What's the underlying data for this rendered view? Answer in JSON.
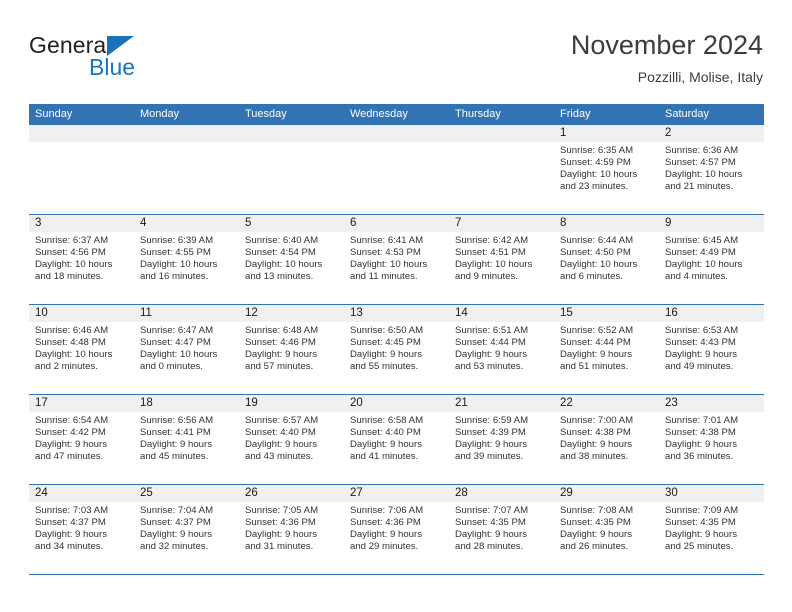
{
  "brand": {
    "name_top": "General",
    "name_bottom": "Blue",
    "accent_color": "#1d71b8",
    "blue_text_color": "#1577c4"
  },
  "header": {
    "title": "November 2024",
    "subtitle": "Pozzilli, Molise, Italy"
  },
  "calendar": {
    "header_bg": "#3273b3",
    "day_band_bg": "#f0f0f0",
    "weekdays": [
      "Sunday",
      "Monday",
      "Tuesday",
      "Wednesday",
      "Thursday",
      "Friday",
      "Saturday"
    ],
    "weeks": [
      [
        {
          "day": "",
          "empty": true
        },
        {
          "day": "",
          "empty": true
        },
        {
          "day": "",
          "empty": true
        },
        {
          "day": "",
          "empty": true
        },
        {
          "day": "",
          "empty": true
        },
        {
          "day": "1",
          "sunrise": "Sunrise: 6:35 AM",
          "sunset": "Sunset: 4:59 PM",
          "daylight1": "Daylight: 10 hours",
          "daylight2": "and 23 minutes."
        },
        {
          "day": "2",
          "sunrise": "Sunrise: 6:36 AM",
          "sunset": "Sunset: 4:57 PM",
          "daylight1": "Daylight: 10 hours",
          "daylight2": "and 21 minutes."
        }
      ],
      [
        {
          "day": "3",
          "sunrise": "Sunrise: 6:37 AM",
          "sunset": "Sunset: 4:56 PM",
          "daylight1": "Daylight: 10 hours",
          "daylight2": "and 18 minutes."
        },
        {
          "day": "4",
          "sunrise": "Sunrise: 6:39 AM",
          "sunset": "Sunset: 4:55 PM",
          "daylight1": "Daylight: 10 hours",
          "daylight2": "and 16 minutes."
        },
        {
          "day": "5",
          "sunrise": "Sunrise: 6:40 AM",
          "sunset": "Sunset: 4:54 PM",
          "daylight1": "Daylight: 10 hours",
          "daylight2": "and 13 minutes."
        },
        {
          "day": "6",
          "sunrise": "Sunrise: 6:41 AM",
          "sunset": "Sunset: 4:53 PM",
          "daylight1": "Daylight: 10 hours",
          "daylight2": "and 11 minutes."
        },
        {
          "day": "7",
          "sunrise": "Sunrise: 6:42 AM",
          "sunset": "Sunset: 4:51 PM",
          "daylight1": "Daylight: 10 hours",
          "daylight2": "and 9 minutes."
        },
        {
          "day": "8",
          "sunrise": "Sunrise: 6:44 AM",
          "sunset": "Sunset: 4:50 PM",
          "daylight1": "Daylight: 10 hours",
          "daylight2": "and 6 minutes."
        },
        {
          "day": "9",
          "sunrise": "Sunrise: 6:45 AM",
          "sunset": "Sunset: 4:49 PM",
          "daylight1": "Daylight: 10 hours",
          "daylight2": "and 4 minutes."
        }
      ],
      [
        {
          "day": "10",
          "sunrise": "Sunrise: 6:46 AM",
          "sunset": "Sunset: 4:48 PM",
          "daylight1": "Daylight: 10 hours",
          "daylight2": "and 2 minutes."
        },
        {
          "day": "11",
          "sunrise": "Sunrise: 6:47 AM",
          "sunset": "Sunset: 4:47 PM",
          "daylight1": "Daylight: 10 hours",
          "daylight2": "and 0 minutes."
        },
        {
          "day": "12",
          "sunrise": "Sunrise: 6:48 AM",
          "sunset": "Sunset: 4:46 PM",
          "daylight1": "Daylight: 9 hours",
          "daylight2": "and 57 minutes."
        },
        {
          "day": "13",
          "sunrise": "Sunrise: 6:50 AM",
          "sunset": "Sunset: 4:45 PM",
          "daylight1": "Daylight: 9 hours",
          "daylight2": "and 55 minutes."
        },
        {
          "day": "14",
          "sunrise": "Sunrise: 6:51 AM",
          "sunset": "Sunset: 4:44 PM",
          "daylight1": "Daylight: 9 hours",
          "daylight2": "and 53 minutes."
        },
        {
          "day": "15",
          "sunrise": "Sunrise: 6:52 AM",
          "sunset": "Sunset: 4:44 PM",
          "daylight1": "Daylight: 9 hours",
          "daylight2": "and 51 minutes."
        },
        {
          "day": "16",
          "sunrise": "Sunrise: 6:53 AM",
          "sunset": "Sunset: 4:43 PM",
          "daylight1": "Daylight: 9 hours",
          "daylight2": "and 49 minutes."
        }
      ],
      [
        {
          "day": "17",
          "sunrise": "Sunrise: 6:54 AM",
          "sunset": "Sunset: 4:42 PM",
          "daylight1": "Daylight: 9 hours",
          "daylight2": "and 47 minutes."
        },
        {
          "day": "18",
          "sunrise": "Sunrise: 6:56 AM",
          "sunset": "Sunset: 4:41 PM",
          "daylight1": "Daylight: 9 hours",
          "daylight2": "and 45 minutes."
        },
        {
          "day": "19",
          "sunrise": "Sunrise: 6:57 AM",
          "sunset": "Sunset: 4:40 PM",
          "daylight1": "Daylight: 9 hours",
          "daylight2": "and 43 minutes."
        },
        {
          "day": "20",
          "sunrise": "Sunrise: 6:58 AM",
          "sunset": "Sunset: 4:40 PM",
          "daylight1": "Daylight: 9 hours",
          "daylight2": "and 41 minutes."
        },
        {
          "day": "21",
          "sunrise": "Sunrise: 6:59 AM",
          "sunset": "Sunset: 4:39 PM",
          "daylight1": "Daylight: 9 hours",
          "daylight2": "and 39 minutes."
        },
        {
          "day": "22",
          "sunrise": "Sunrise: 7:00 AM",
          "sunset": "Sunset: 4:38 PM",
          "daylight1": "Daylight: 9 hours",
          "daylight2": "and 38 minutes."
        },
        {
          "day": "23",
          "sunrise": "Sunrise: 7:01 AM",
          "sunset": "Sunset: 4:38 PM",
          "daylight1": "Daylight: 9 hours",
          "daylight2": "and 36 minutes."
        }
      ],
      [
        {
          "day": "24",
          "sunrise": "Sunrise: 7:03 AM",
          "sunset": "Sunset: 4:37 PM",
          "daylight1": "Daylight: 9 hours",
          "daylight2": "and 34 minutes."
        },
        {
          "day": "25",
          "sunrise": "Sunrise: 7:04 AM",
          "sunset": "Sunset: 4:37 PM",
          "daylight1": "Daylight: 9 hours",
          "daylight2": "and 32 minutes."
        },
        {
          "day": "26",
          "sunrise": "Sunrise: 7:05 AM",
          "sunset": "Sunset: 4:36 PM",
          "daylight1": "Daylight: 9 hours",
          "daylight2": "and 31 minutes."
        },
        {
          "day": "27",
          "sunrise": "Sunrise: 7:06 AM",
          "sunset": "Sunset: 4:36 PM",
          "daylight1": "Daylight: 9 hours",
          "daylight2": "and 29 minutes."
        },
        {
          "day": "28",
          "sunrise": "Sunrise: 7:07 AM",
          "sunset": "Sunset: 4:35 PM",
          "daylight1": "Daylight: 9 hours",
          "daylight2": "and 28 minutes."
        },
        {
          "day": "29",
          "sunrise": "Sunrise: 7:08 AM",
          "sunset": "Sunset: 4:35 PM",
          "daylight1": "Daylight: 9 hours",
          "daylight2": "and 26 minutes."
        },
        {
          "day": "30",
          "sunrise": "Sunrise: 7:09 AM",
          "sunset": "Sunset: 4:35 PM",
          "daylight1": "Daylight: 9 hours",
          "daylight2": "and 25 minutes."
        }
      ]
    ]
  }
}
